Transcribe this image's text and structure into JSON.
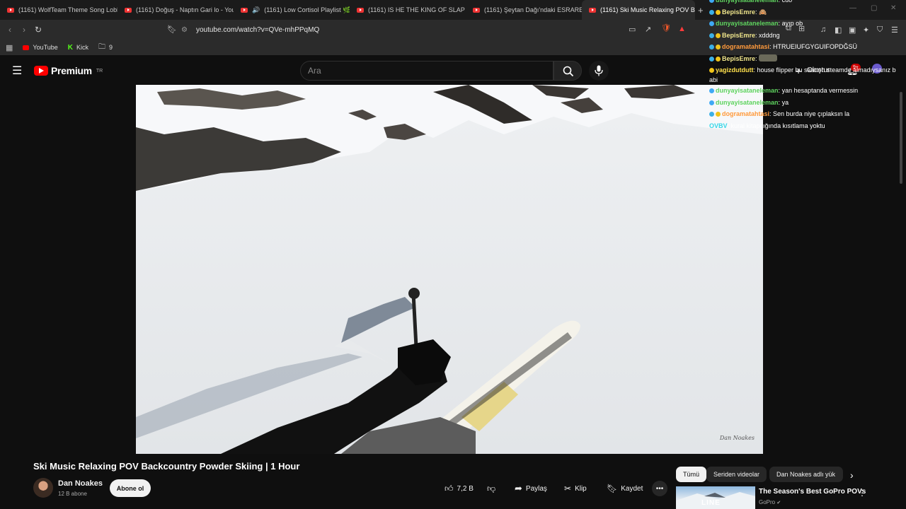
{
  "browser": {
    "tabs": [
      {
        "label": "(1161) WolfTeam Theme Song Lobby"
      },
      {
        "label": "(1161) Doğuş - Naptın Gari lo - YouT"
      },
      {
        "label": "(1161) Low Cortisol Playlist 🌿"
      },
      {
        "label": "(1161) IS HE THE KING OF SLAP FIGH"
      },
      {
        "label": "(1161) Şeytan Dağı'ndaki ESRARENG"
      },
      {
        "label": "(1161) Ski Music Relaxing POV B"
      }
    ],
    "new_tab": "+",
    "url": "youtube.com/watch?v=QVe-mhPPqMQ",
    "bookmarks": [
      {
        "label": "YouTube"
      },
      {
        "label": "Kick"
      },
      {
        "label": "9"
      }
    ]
  },
  "youtube": {
    "logo_text": "Premium",
    "logo_region": "TR",
    "search_placeholder": "Ara",
    "video_title": "Ski Music Relaxing POV Backcountry Powder Skiing | 1 Hour",
    "channel": "Dan Noakes",
    "subscribers": "12 B abone",
    "subscribe_label": "Abone ol",
    "likes": "7,2 B",
    "share_label": "Paylaş",
    "clip_label": "Klip",
    "save_label": "Kaydet",
    "watermark": "Dan Noakes",
    "chips": [
      "Tümü",
      "Seriden videolar",
      "Dan Noakes adlı yük"
    ],
    "recommendation": {
      "title": "The Season's Best GoPro POVs",
      "channel": "GoPro",
      "thumb_text": "LINE"
    },
    "header_overlap_text": "Oluştur",
    "notification_count": "9+"
  },
  "chat": {
    "messages": [
      {
        "user": "dunyayisataneleman",
        "text": "cuo",
        "color": "#5fd35f"
      },
      {
        "user": "BepisEmre",
        "text": "🙈",
        "color": "#f0e68c"
      },
      {
        "user": "dunyayisataneleman",
        "text": "ayıp ob",
        "color": "#5fd35f"
      },
      {
        "user": "BepisEmre",
        "text": "xdddng",
        "color": "#f0e68c"
      },
      {
        "user": "dogramatahtasi",
        "text": "HTRUEIUFGYGUIFOPDĞSÜ",
        "color": "#ff9a3c"
      },
      {
        "user": "BepisEmre",
        "text": "",
        "color": "#f0e68c"
      },
      {
        "user": "yagizdutdutt",
        "text": "house flipper bu saatten steamde almadıysanız b abi",
        "color": "#ffe14d"
      },
      {
        "user": "dunyayisataneleman",
        "text": "yan hesaptanda vermessin",
        "color": "#5fd35f"
      },
      {
        "user": "dunyayisataneleman",
        "text": "ya",
        "color": "#5fd35f"
      },
      {
        "user": "dogramatahtasi",
        "text": "Sen burda niye çıplaksın la",
        "color": "#ff9a3c"
      },
      {
        "user": "OVBV",
        "text": "kural kitapçığında kısıtlama yoktu",
        "color": "#35d7e8"
      }
    ]
  }
}
